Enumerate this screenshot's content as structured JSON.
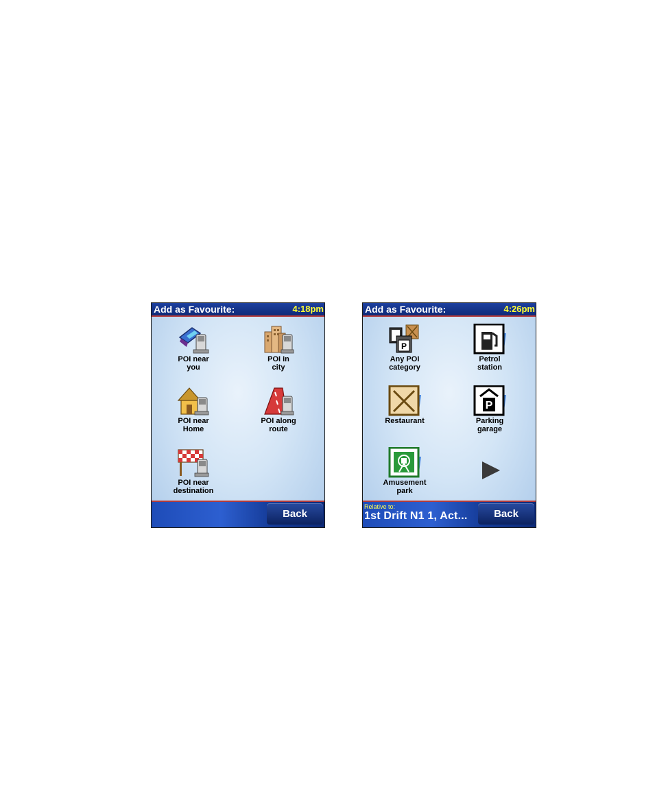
{
  "left_screen": {
    "title": "Add as Favourite:",
    "time": "4:18pm",
    "items": [
      {
        "label": "POI near\nyou",
        "icon": "poi-near-you-icon"
      },
      {
        "label": "POI in\ncity",
        "icon": "poi-in-city-icon"
      },
      {
        "label": "POI near\nHome",
        "icon": "poi-near-home-icon"
      },
      {
        "label": "POI along\nroute",
        "icon": "poi-along-route-icon"
      },
      {
        "label": "POI near\ndestination",
        "icon": "poi-near-destination-icon"
      }
    ],
    "back_label": "Back"
  },
  "right_screen": {
    "title": "Add as Favourite:",
    "time": "4:26pm",
    "items": [
      {
        "label": "Any POI\ncategory",
        "icon": "any-poi-category-icon"
      },
      {
        "label": "Petrol\nstation",
        "icon": "petrol-station-icon"
      },
      {
        "label": "Restaurant",
        "icon": "restaurant-icon"
      },
      {
        "label": "Parking\ngarage",
        "icon": "parking-garage-icon"
      },
      {
        "label": "Amusement\npark",
        "icon": "amusement-park-icon"
      }
    ],
    "next_icon": "next-arrow-icon",
    "relative_label": "Relative to:",
    "relative_value": "1st Drift N1 1, Act...",
    "back_label": "Back"
  },
  "colors": {
    "titlebar": "#1c3f9e",
    "time_text": "#ffff33",
    "accent_line": "#b33a3a",
    "background": "#d3e5f6"
  }
}
